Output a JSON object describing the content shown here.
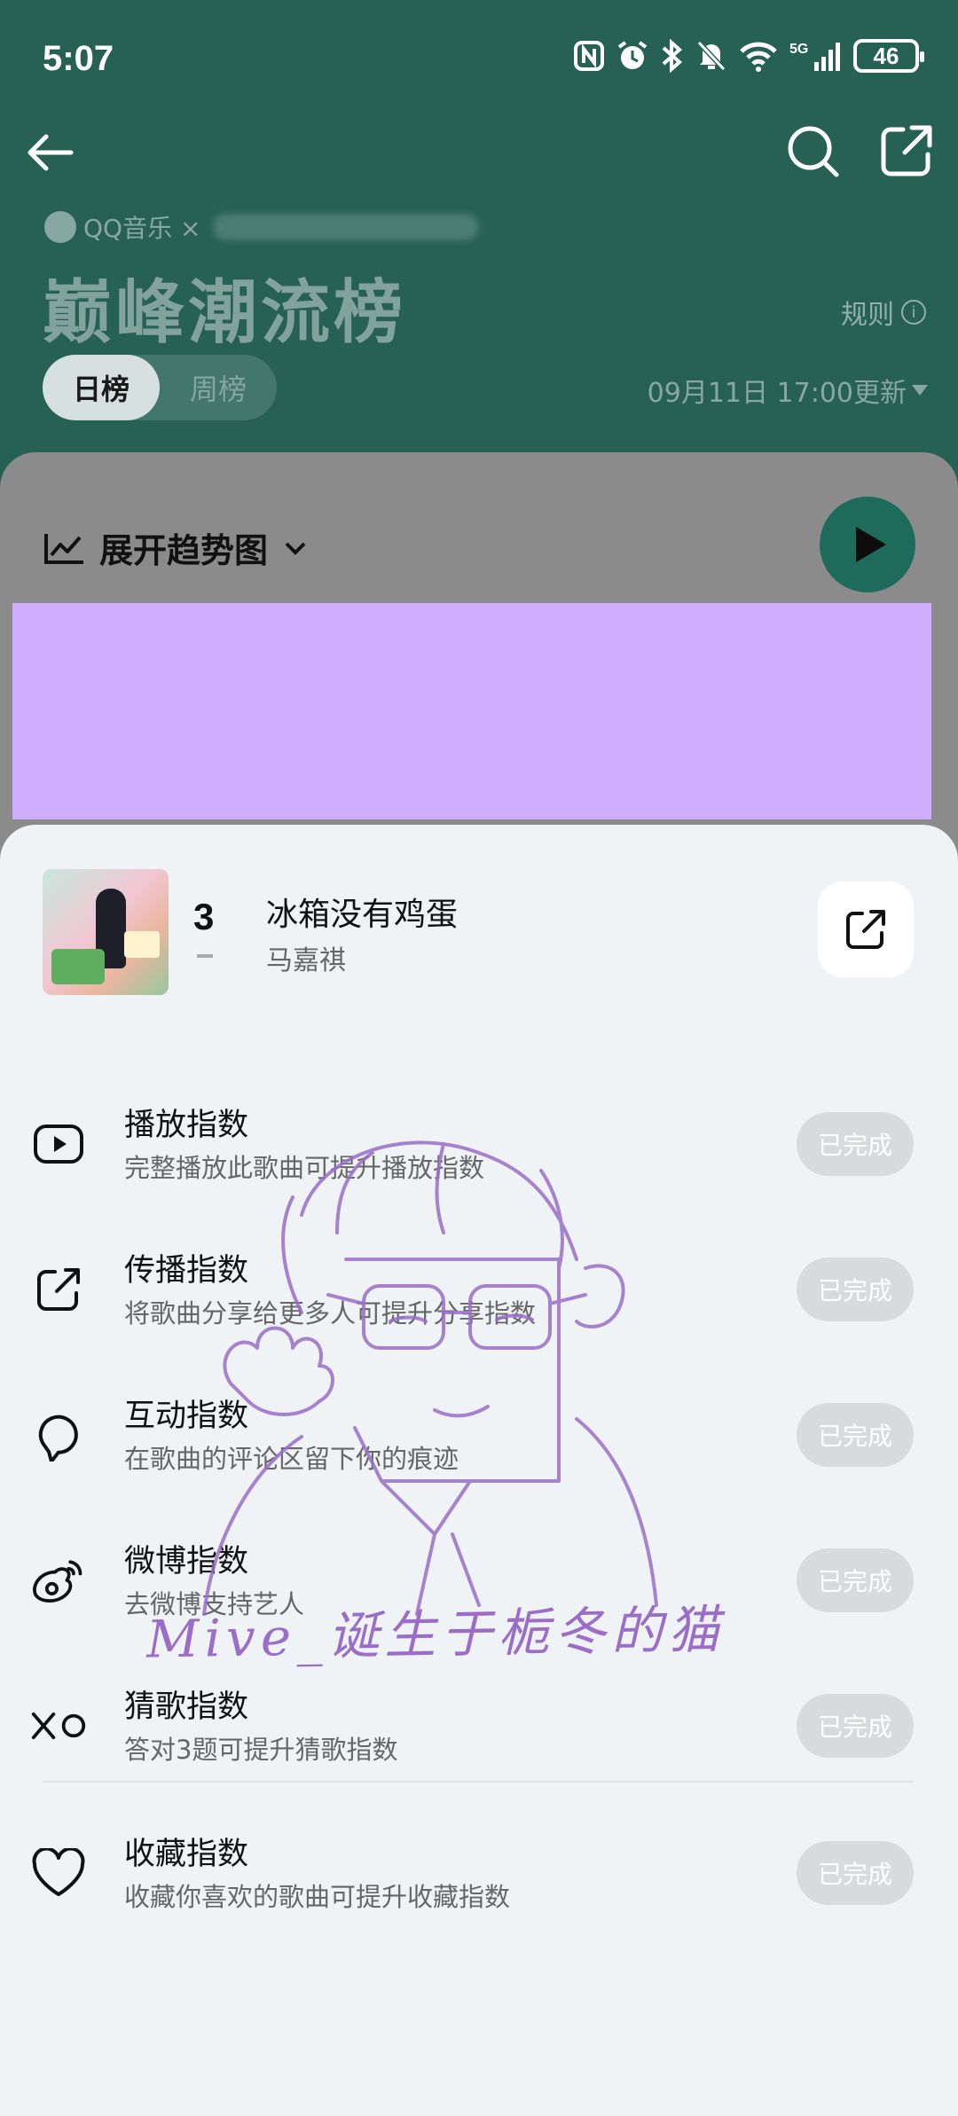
{
  "status": {
    "time": "5:07",
    "battery": "46"
  },
  "header": {
    "brand": "QQ音乐 ×",
    "title": "巅峰潮流榜",
    "rules_label": "规则",
    "tabs": [
      {
        "label": "日榜",
        "active": true
      },
      {
        "label": "周榜",
        "active": false
      }
    ],
    "update_time": "09月11日 17:00更新"
  },
  "chart_section": {
    "trend_label": "展开趋势图"
  },
  "song": {
    "rank": "3",
    "title": "冰箱没有鸡蛋",
    "artist": "马嘉祺"
  },
  "tasks": [
    {
      "name": "播放指数",
      "desc": "完整播放此歌曲可提升播放指数",
      "status": "已完成",
      "icon": "play-icon"
    },
    {
      "name": "传播指数",
      "desc": "将歌曲分享给更多人可提升分享指数",
      "status": "已完成",
      "icon": "share-icon"
    },
    {
      "name": "互动指数",
      "desc": "在歌曲的评论区留下你的痕迹",
      "status": "已完成",
      "icon": "comment-icon"
    },
    {
      "name": "微博指数",
      "desc": "去微博支持艺人",
      "status": "已完成",
      "icon": "weibo-icon"
    },
    {
      "name": "猜歌指数",
      "desc": "答对3题可提升猜歌指数",
      "status": "已完成",
      "icon": "tic-tac-toe-icon"
    },
    {
      "name": "收藏指数",
      "desc": "收藏你喜欢的歌曲可提升收藏指数",
      "status": "已完成",
      "icon": "heart-icon"
    }
  ],
  "watermark": {
    "text": "Mive_诞生于栀冬的猫"
  },
  "colors": {
    "header_bg": "#266154",
    "accent": "#1e6b5c",
    "redaction": "#cfaeff",
    "sheet_bg": "#eff3f6",
    "watermark": "#9a6ec8"
  }
}
